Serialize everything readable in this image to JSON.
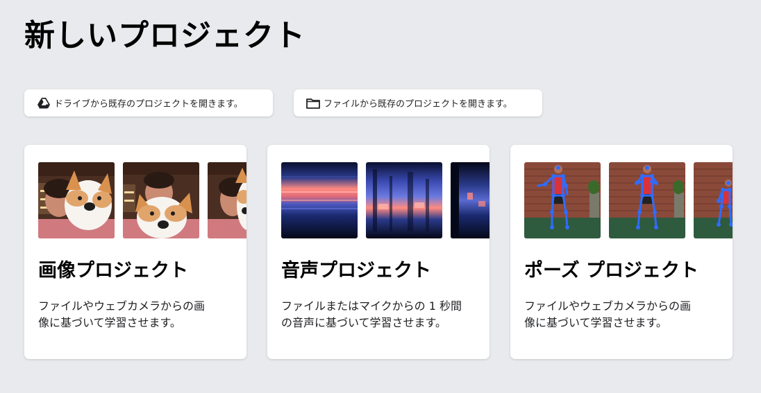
{
  "page": {
    "title": "新しいプロジェクト"
  },
  "open_buttons": {
    "drive": {
      "label": "ドライブから既存のプロジェクトを開きます。",
      "icon": "google-drive-icon"
    },
    "file": {
      "label": "ファイルから既存のプロジェクトを開きます。",
      "icon": "folder-icon"
    }
  },
  "cards": [
    {
      "title": "画像プロジェクト",
      "description": "ファイルやウェブカメラからの画\n像に基づいて学習させます。",
      "thumbnails": [
        "person-with-plush-dog-image",
        "person-with-plush-dog-image",
        "person-with-plush-dog-image"
      ]
    },
    {
      "title": "音声プロジェクト",
      "description": "ファイルまたはマイクからの 1 秒間\nの音声に基づいて学習させます。",
      "thumbnails": [
        "spectrogram-image",
        "spectrogram-image",
        "spectrogram-image"
      ]
    },
    {
      "title": "ポーズ プロジェクト",
      "description": "ファイルやウェブカメラからの画\n像に基づいて学習させます。",
      "thumbnails": [
        "pose-skeleton-image",
        "pose-skeleton-image",
        "pose-skeleton-image"
      ]
    }
  ],
  "colors": {
    "background": "#e8eaed",
    "card": "#ffffff",
    "skeleton": "#2f6cff",
    "spectrogram_dark": "#0a1030",
    "spectrogram_hot": "#ff8a80"
  }
}
